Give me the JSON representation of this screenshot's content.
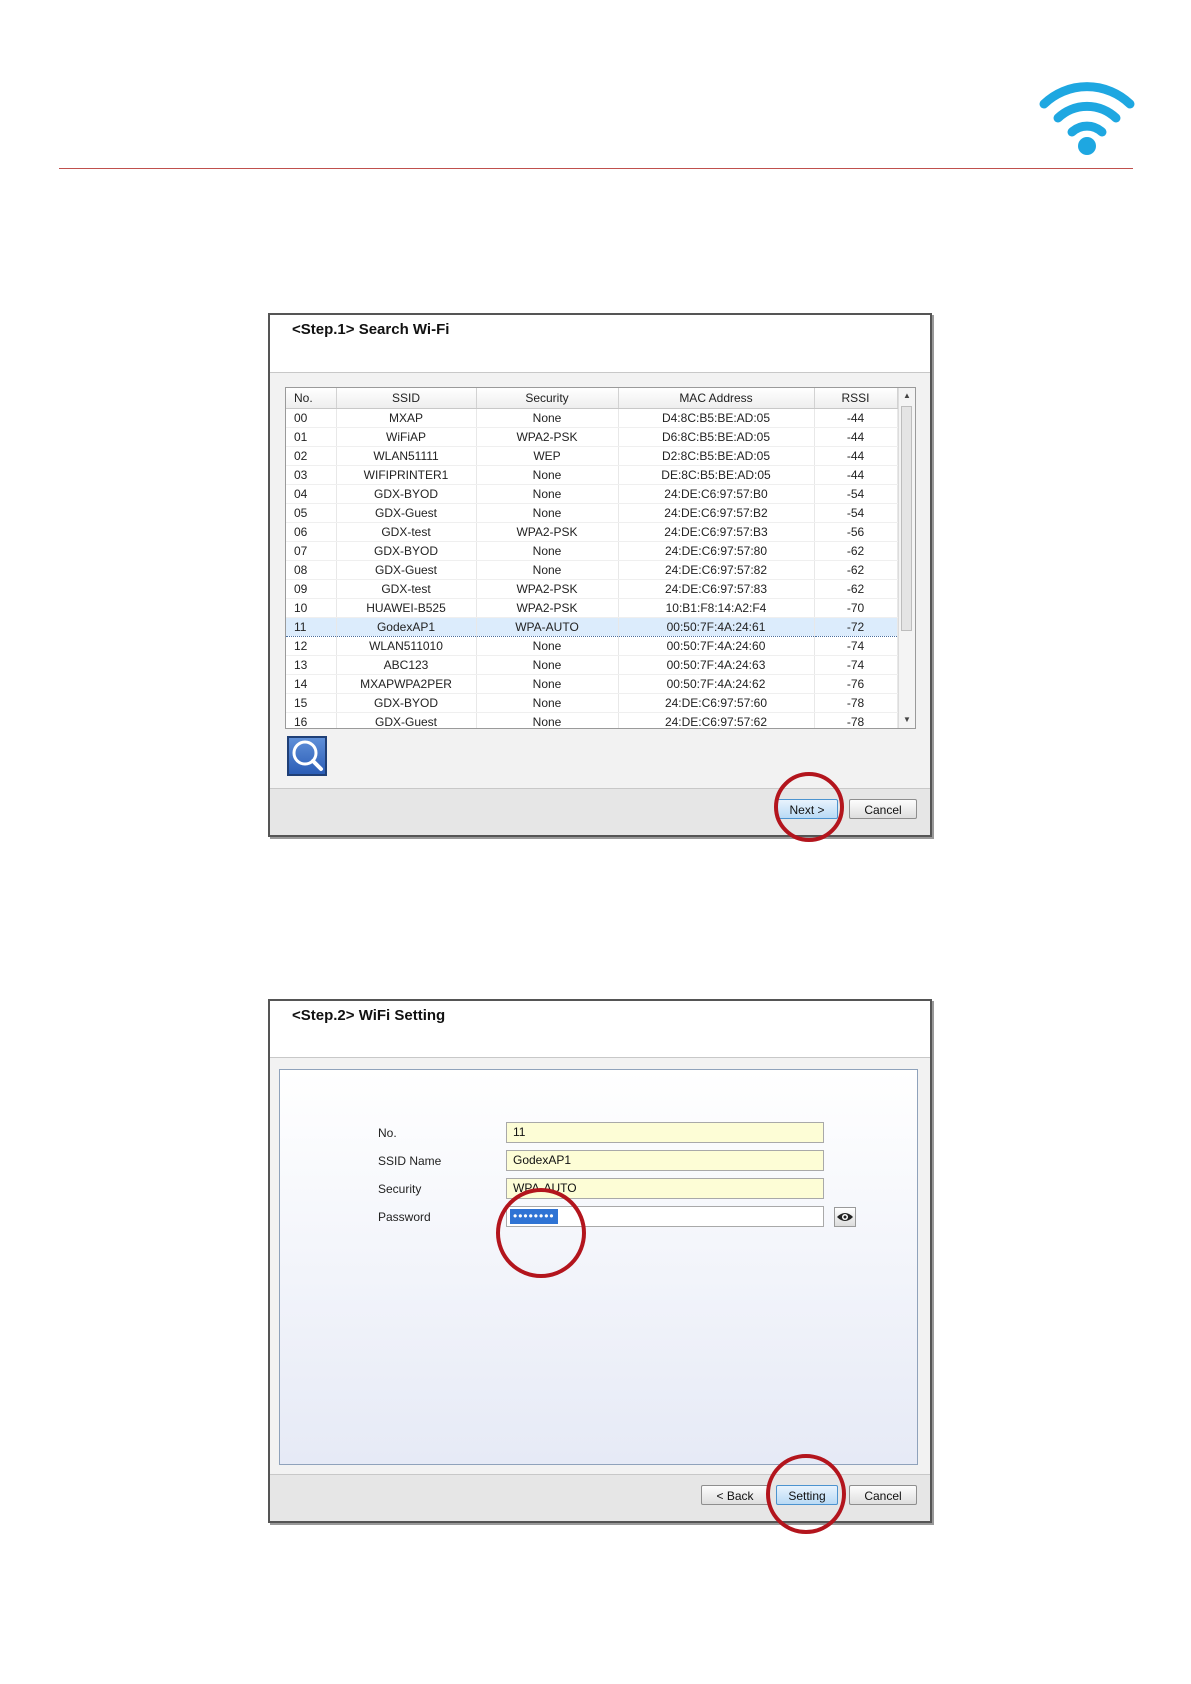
{
  "step1": {
    "title": "<Step.1>  Search Wi-Fi",
    "columns": [
      "No.",
      "SSID",
      "Security",
      "MAC Address",
      "RSSI"
    ],
    "rows": [
      [
        "00",
        "MXAP",
        "None",
        "D4:8C:B5:BE:AD:05",
        "-44"
      ],
      [
        "01",
        "WiFiAP",
        "WPA2-PSK",
        "D6:8C:B5:BE:AD:05",
        "-44"
      ],
      [
        "02",
        "WLAN51111",
        "WEP",
        "D2:8C:B5:BE:AD:05",
        "-44"
      ],
      [
        "03",
        "WIFIPRINTER1",
        "None",
        "DE:8C:B5:BE:AD:05",
        "-44"
      ],
      [
        "04",
        "GDX-BYOD",
        "None",
        "24:DE:C6:97:57:B0",
        "-54"
      ],
      [
        "05",
        "GDX-Guest",
        "None",
        "24:DE:C6:97:57:B2",
        "-54"
      ],
      [
        "06",
        "GDX-test",
        "WPA2-PSK",
        "24:DE:C6:97:57:B3",
        "-56"
      ],
      [
        "07",
        "GDX-BYOD",
        "None",
        "24:DE:C6:97:57:80",
        "-62"
      ],
      [
        "08",
        "GDX-Guest",
        "None",
        "24:DE:C6:97:57:82",
        "-62"
      ],
      [
        "09",
        "GDX-test",
        "WPA2-PSK",
        "24:DE:C6:97:57:83",
        "-62"
      ],
      [
        "10",
        "HUAWEI-B525",
        "WPA2-PSK",
        "10:B1:F8:14:A2:F4",
        "-70"
      ],
      [
        "11",
        "GodexAP1",
        "WPA-AUTO",
        "00:50:7F:4A:24:61",
        "-72"
      ],
      [
        "12",
        "WLAN511010",
        "None",
        "00:50:7F:4A:24:60",
        "-74"
      ],
      [
        "13",
        "ABC123",
        "None",
        "00:50:7F:4A:24:63",
        "-74"
      ],
      [
        "14",
        "MXAPWPA2PER",
        "None",
        "00:50:7F:4A:24:62",
        "-76"
      ],
      [
        "15",
        "GDX-BYOD",
        "None",
        "24:DE:C6:97:57:60",
        "-78"
      ],
      [
        "16",
        "GDX-Guest",
        "None",
        "24:DE:C6:97:57:62",
        "-78"
      ]
    ],
    "selected_row": "11",
    "search_icon": "magnifier-icon",
    "next_label": "Next >",
    "cancel_label": "Cancel"
  },
  "step2": {
    "title": "<Step.2> WiFi Setting",
    "labels": {
      "no": "No.",
      "ssid": "SSID Name",
      "security": "Security",
      "password": "Password"
    },
    "values": {
      "no": "11",
      "ssid": "GodexAP1",
      "security": "WPA-AUTO",
      "password": "••••••••"
    },
    "show_password_icon": "eye-icon",
    "back_label": "< Back",
    "setting_label": "Setting",
    "cancel_label": "Cancel"
  },
  "colors": {
    "wifi_logo": "#1ea7e1",
    "rule": "#c0504d",
    "highlight_circle": "#b3151d",
    "selected_row": "#dcecfc",
    "input_fill": "#fdfdd6"
  }
}
